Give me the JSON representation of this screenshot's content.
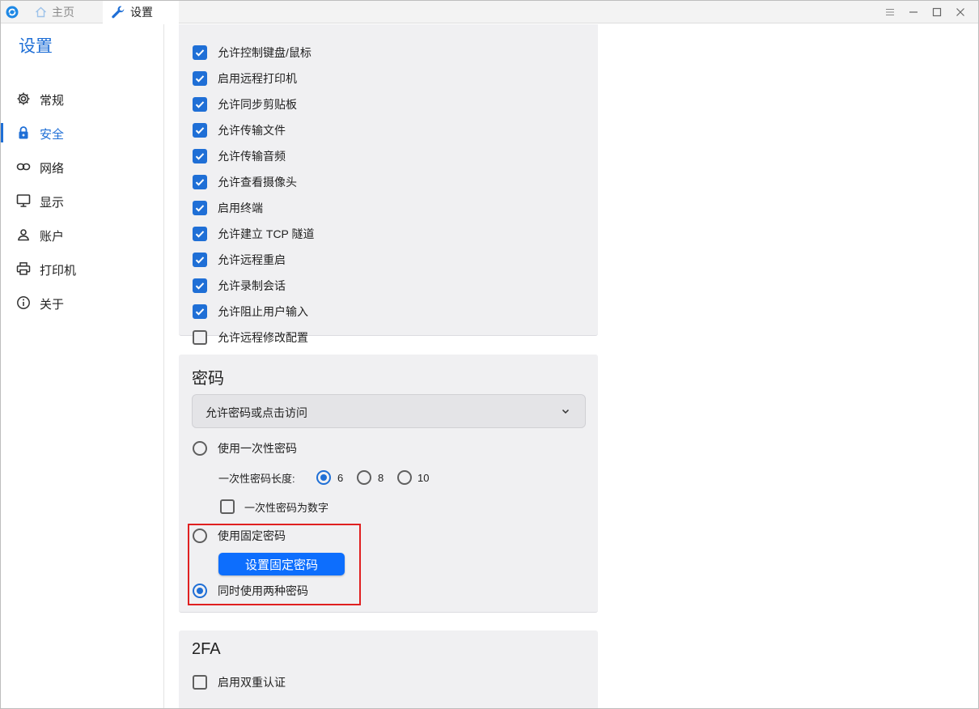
{
  "titlebar": {
    "tab_home": "主页",
    "tab_settings": "设置"
  },
  "sidebar": {
    "title": "设置",
    "items": [
      {
        "label": "常规",
        "icon": "gear-icon"
      },
      {
        "label": "安全",
        "icon": "lock-icon",
        "active": true
      },
      {
        "label": "网络",
        "icon": "link-icon"
      },
      {
        "label": "显示",
        "icon": "monitor-icon"
      },
      {
        "label": "账户",
        "icon": "user-icon"
      },
      {
        "label": "打印机",
        "icon": "printer-icon"
      },
      {
        "label": "关于",
        "icon": "info-icon"
      }
    ]
  },
  "permissions": {
    "items": [
      {
        "label": "允许控制键盘/鼠标",
        "checked": true
      },
      {
        "label": "启用远程打印机",
        "checked": true
      },
      {
        "label": "允许同步剪贴板",
        "checked": true
      },
      {
        "label": "允许传输文件",
        "checked": true
      },
      {
        "label": "允许传输音频",
        "checked": true
      },
      {
        "label": "允许查看摄像头",
        "checked": true
      },
      {
        "label": "启用终端",
        "checked": true
      },
      {
        "label": "允许建立 TCP 隧道",
        "checked": true
      },
      {
        "label": "允许远程重启",
        "checked": true
      },
      {
        "label": "允许录制会话",
        "checked": true
      },
      {
        "label": "允许阻止用户输入",
        "checked": true
      },
      {
        "label": "允许远程修改配置",
        "checked": false
      }
    ]
  },
  "password": {
    "title": "密码",
    "access_mode": "允许密码或点击访问",
    "one_time": {
      "label": "使用一次性密码",
      "selected": false
    },
    "length_label": "一次性密码长度:",
    "length_options": [
      {
        "label": "6",
        "selected": true
      },
      {
        "label": "8",
        "selected": false
      },
      {
        "label": "10",
        "selected": false
      }
    ],
    "numeric_label": "一次性密码为数字",
    "numeric_checked": false,
    "fixed": {
      "label": "使用固定密码",
      "selected": false
    },
    "set_fixed_button": "设置固定密码",
    "both": {
      "label": "同时使用两种密码",
      "selected": true
    }
  },
  "twofa": {
    "title": "2FA",
    "enable_label": "启用双重认证",
    "enabled": false
  },
  "colors": {
    "accent": "#1f6fd6",
    "button": "#0d6efd",
    "highlight": "#e02020",
    "card_bg": "#f0f0f2"
  }
}
